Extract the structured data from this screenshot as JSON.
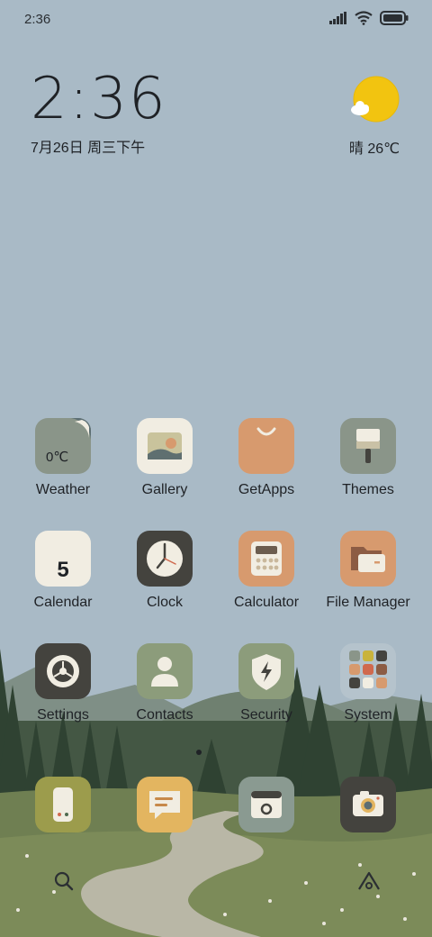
{
  "status_bar": {
    "time": "2:36",
    "signal_icon": "signal-icon",
    "wifi_icon": "wifi-icon",
    "battery_icon": "battery-icon"
  },
  "clock_widget": {
    "time": "2:36",
    "date": "7月26日 周三下午"
  },
  "weather_widget": {
    "icon": "sunny-cloud-icon",
    "text": "晴 26℃"
  },
  "apps": [
    {
      "label": "Weather",
      "sub": "0℃",
      "icon": "weather-icon"
    },
    {
      "label": "Gallery",
      "icon": "gallery-icon"
    },
    {
      "label": "GetApps",
      "icon": "getapps-icon"
    },
    {
      "label": "Themes",
      "icon": "themes-icon"
    },
    {
      "label": "Calendar",
      "sub": "5",
      "icon": "calendar-icon"
    },
    {
      "label": "Clock",
      "icon": "clock-icon"
    },
    {
      "label": "Calculator",
      "icon": "calculator-icon"
    },
    {
      "label": "File Manager",
      "icon": "file-manager-icon"
    },
    {
      "label": "Settings",
      "icon": "settings-icon"
    },
    {
      "label": "Contacts",
      "icon": "contacts-icon"
    },
    {
      "label": "Security",
      "icon": "security-icon"
    },
    {
      "label": "System",
      "icon": "folder-icon"
    }
  ],
  "dock": [
    {
      "name": "phone-icon"
    },
    {
      "name": "messages-icon"
    },
    {
      "name": "browser-icon"
    },
    {
      "name": "camera-icon"
    }
  ],
  "nav": {
    "search_icon": "search-icon",
    "app_vault_icon": "app-vault-icon"
  },
  "colors": {
    "sky": "#a9bac6",
    "accent_orange": "#d79a6e",
    "accent_sage": "#8c9c7b",
    "dark_tile": "#44433e"
  }
}
